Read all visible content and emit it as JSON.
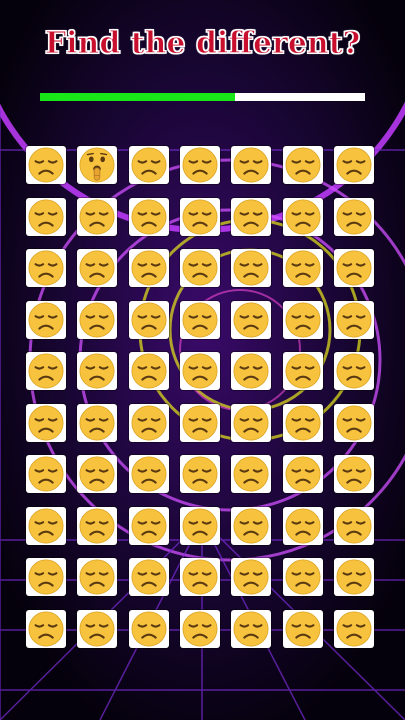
{
  "title": "Find the different?",
  "progress": 0.6,
  "grid": {
    "rows": 10,
    "cols": 7,
    "common_icon": "disappointed-face-emoji",
    "odd_icon": "shushing-face-emoji",
    "odd_row": 0,
    "odd_col": 1
  },
  "colors": {
    "title": "#c8102e",
    "progress_fill": "#19e619",
    "progress_track": "#ffffff",
    "emoji_face": "#f7c23e",
    "background": "#0a0218"
  }
}
